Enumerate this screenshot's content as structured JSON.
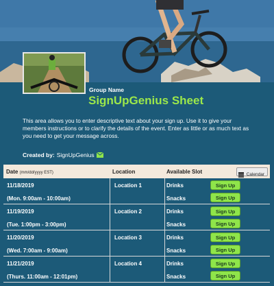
{
  "header": {
    "group_label": "Group Name",
    "title": "SignUpGenius Sheet",
    "description": "This area allows you to enter descriptive text about your sign up. Use it to give your members instructions or to clarify the details of the event. Enter as little or as much text as you need to get your message across.",
    "created_by_label": "Created by:",
    "created_by_name": "SignUpGenius"
  },
  "table": {
    "columns": {
      "date": "Date",
      "date_format": "(mm/dd/yyyy EST)",
      "location": "Location",
      "slot": "Available Slot"
    },
    "calendar_label": "Calendar",
    "rows": [
      {
        "date": "11/18/2019",
        "time": "(Mon. 9:00am - 10:00am)",
        "location": "Location 1",
        "slots": [
          "Drinks",
          "Snacks"
        ]
      },
      {
        "date": "11/19/2019",
        "time": "(Tue. 1:00pm - 3:00pm)",
        "location": "Location 2",
        "slots": [
          "Drinks",
          "Snacks"
        ]
      },
      {
        "date": "11/20/2019",
        "time": "(Wed. 7:00am - 9:00am)",
        "location": "Location 3",
        "slots": [
          "Drinks",
          "Snacks"
        ]
      },
      {
        "date": "11/21/2019",
        "time": "(Thurs. 11:00am - 12:01pm)",
        "location": "Location 4",
        "slots": [
          "Drinks",
          "Snacks"
        ]
      }
    ],
    "signup_label": "Sign Up"
  },
  "colors": {
    "background": "#1c5a78",
    "title_green": "#9ce84a",
    "button_green": "#8fe54a",
    "header_row": "#f3e9dc"
  },
  "icons": [
    "mail-icon",
    "calendar-icon"
  ]
}
